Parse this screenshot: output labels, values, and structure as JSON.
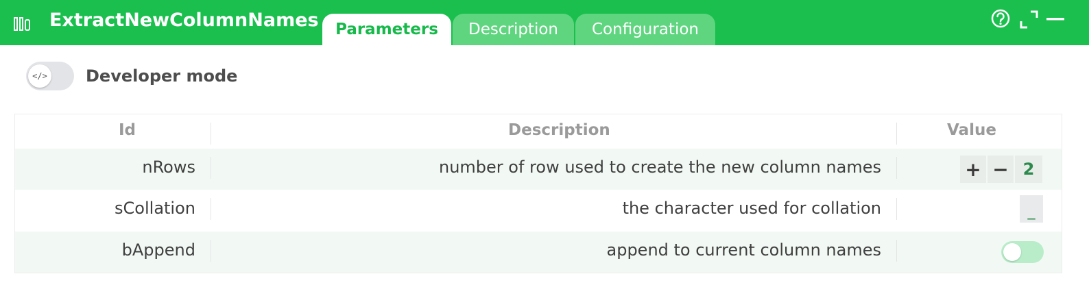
{
  "header": {
    "title": "ExtractNewColumnNames",
    "tabs": [
      {
        "label": "Parameters",
        "active": true
      },
      {
        "label": "Description",
        "active": false
      },
      {
        "label": "Configuration",
        "active": false
      }
    ],
    "icons": [
      "panel-icon",
      "help-icon",
      "fullscreen-icon",
      "minimize-icon"
    ],
    "accent_color": "#1abf4e"
  },
  "developer_mode": {
    "label": "Developer mode",
    "toggle_icon_text": "</>",
    "enabled": false
  },
  "table": {
    "columns": [
      "Id",
      "Description",
      "Value"
    ],
    "rows": [
      {
        "id": "nRows",
        "description": "number of row used to create the new column names",
        "value_type": "stepper",
        "plus_symbol": "+",
        "minus_symbol": "−",
        "value": "2"
      },
      {
        "id": "sCollation",
        "description": "the character used for collation",
        "value_type": "text",
        "value": "_"
      },
      {
        "id": "bAppend",
        "description": "append to current column names",
        "value_type": "toggle",
        "checked": false
      }
    ]
  }
}
